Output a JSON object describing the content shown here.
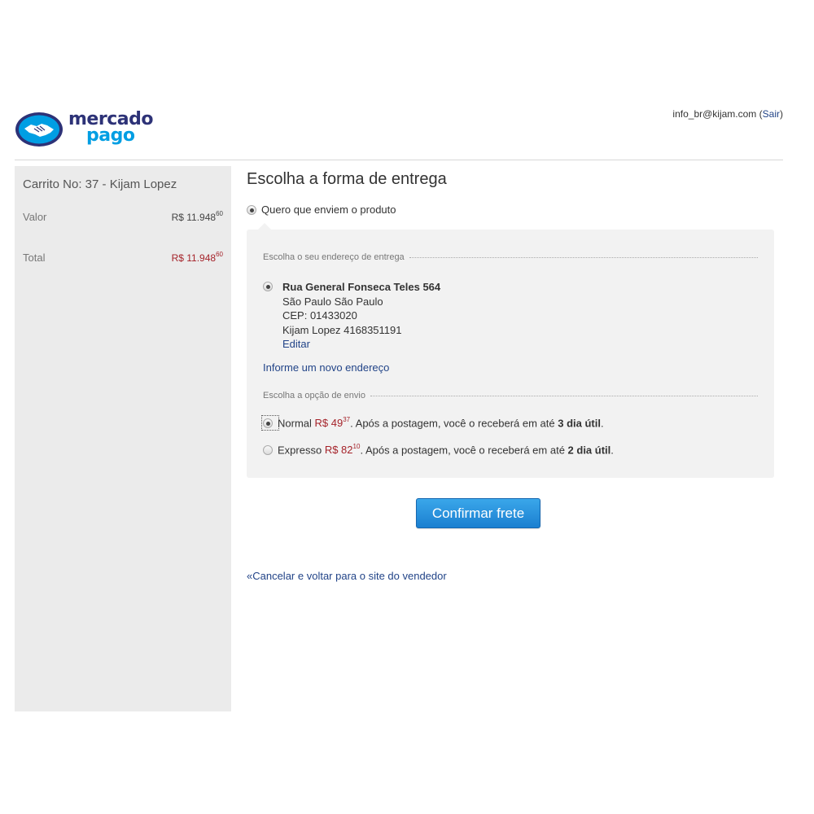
{
  "header": {
    "logo_line1": "mercado",
    "logo_line2": "pago",
    "user_email": "info_br@kijam.com",
    "logout_label": "Sair"
  },
  "sidebar": {
    "cart_title": "Carrito No: 37 - Kijam Lopez",
    "rows": [
      {
        "label": "Valor",
        "amount_main": "R$ 11.948",
        "amount_cents": "60"
      },
      {
        "label": "Total",
        "amount_main": "R$ 11.948",
        "amount_cents": "60"
      }
    ]
  },
  "main": {
    "title": "Escolha a forma de entrega",
    "delivery_option": "Quero que enviem o produto",
    "address_section_label": "Escolha o seu endereço de entrega",
    "address": {
      "street": "Rua General Fonseca Teles 564",
      "city": "São Paulo São Paulo",
      "cep": "CEP: 01433020",
      "recipient": "Kijam Lopez 4168351191",
      "edit_label": "Editar"
    },
    "new_address_link": "Informe um novo endereço",
    "shipping_section_label": "Escolha a opção de envio",
    "shipping_options": [
      {
        "name": "Normal",
        "price_main": "R$ 49",
        "price_cents": "37",
        "text_before": ". Após a postagem, você o receberá em até ",
        "days": "3 dia útil",
        "text_after": "."
      },
      {
        "name": "Expresso",
        "price_main": "R$ 82",
        "price_cents": "10",
        "text_before": ". Após a postagem, você o receberá em até ",
        "days": "2 dia útil",
        "text_after": "."
      }
    ],
    "confirm_label": "Confirmar frete",
    "cancel_link": "«Cancelar e voltar para o site do vendedor"
  },
  "colors": {
    "brand_dark": "#2d3277",
    "brand_light": "#009ee3",
    "price_red": "#a5232a",
    "button_blue": "#1b7fd0",
    "link_blue": "#224488"
  }
}
